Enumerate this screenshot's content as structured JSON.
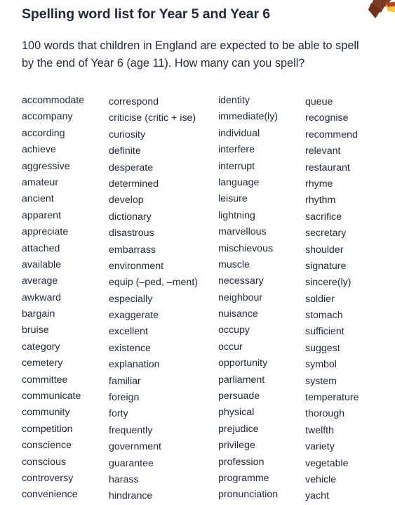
{
  "header": {
    "title": "Spelling word list for Year 5 and Year 6",
    "subtitle": "100 words that children in England are expected to be able to spell by the end of Year 6 (age 11). How many can you spell?"
  },
  "decoration": {
    "icon_name": "corner-illustration",
    "colors": {
      "primary": "#7c3a22",
      "accent": "#f2c53d",
      "secondary": "#b5451f"
    }
  },
  "colors": {
    "text": "#1f2a3a",
    "background": "#ffffff"
  },
  "wordlist": {
    "total_count": 100,
    "columns": [
      {
        "index": 1,
        "words": [
          "accommodate",
          "accompany",
          "according",
          "achieve",
          "aggressive",
          "amateur",
          "ancient",
          "apparent",
          "appreciate",
          "attached",
          "available",
          "average",
          "awkward",
          "bargain",
          "bruise",
          "category",
          "cemetery",
          "committee",
          "communicate",
          "community",
          "competition",
          "conscience",
          "conscious",
          "controversy",
          "convenience"
        ]
      },
      {
        "index": 2,
        "words": [
          "correspond",
          "criticise (critic + ise)",
          "curiosity",
          "definite",
          "desperate",
          "determined",
          "develop",
          "dictionary",
          "disastrous",
          "embarrass",
          "environment",
          "equip (–ped, –ment)",
          "especially",
          "exaggerate",
          "excellent",
          "existence",
          "explanation",
          "familiar",
          "foreign",
          "forty",
          "frequently",
          "government",
          "guarantee",
          "harass",
          "hindrance"
        ]
      },
      {
        "index": 3,
        "words": [
          "identity",
          "immediate(ly)",
          "individual",
          "interfere",
          "interrupt",
          "language",
          "leisure",
          "lightning",
          "marvellous",
          "mischievous",
          "muscle",
          "necessary",
          "neighbour",
          "nuisance",
          "occupy",
          "occur",
          "opportunity",
          "parliament",
          "persuade",
          "physical",
          "prejudice",
          "privilege",
          "profession",
          "programme",
          "pronunciation"
        ]
      },
      {
        "index": 4,
        "words": [
          "queue",
          "recognise",
          "recommend",
          "relevant",
          "restaurant",
          "rhyme",
          "rhythm",
          "sacrifice",
          "secretary",
          "shoulder",
          "signature",
          "sincere(ly)",
          "soldier",
          "stomach",
          "sufficient",
          "suggest",
          "symbol",
          "system",
          "temperature",
          "thorough",
          "twelfth",
          "variety",
          "vegetable",
          "vehicle",
          "yacht"
        ]
      }
    ]
  }
}
